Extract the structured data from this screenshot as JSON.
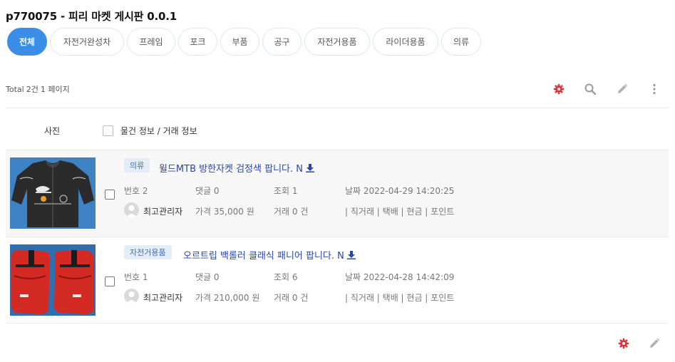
{
  "board": {
    "title": "p770075 - 피리 마켓 게시판 0.0.1"
  },
  "tabs": [
    {
      "label": "전체",
      "active": true
    },
    {
      "label": "자전거완성차"
    },
    {
      "label": "프레임"
    },
    {
      "label": "포크"
    },
    {
      "label": "부품"
    },
    {
      "label": "공구"
    },
    {
      "label": "자전거용품"
    },
    {
      "label": "라이더용품"
    },
    {
      "label": "의류"
    }
  ],
  "summary": {
    "total_label": "Total",
    "total_count": "2건",
    "page": "1 페이지"
  },
  "toolbar_icons": [
    "settings-icon",
    "search-icon",
    "pencil-icon",
    "more-vertical-icon"
  ],
  "list_header": {
    "photo": "사진",
    "info": "물건 정보 / 거래 정보"
  },
  "items": [
    {
      "category": "의류",
      "title": "윌드MTB 방한자켓 검정색 팝니다. N",
      "number": "번호 2",
      "comments": "댓글 0",
      "views": "조회 1",
      "date": "날짜 2022-04-29 14:20:25",
      "author": "최고관리자",
      "price": "가격 35,000 원",
      "trades": "거래 0 건",
      "trade_methods": "| 직거래 | 택배 | 현금 | 포인트",
      "thumb": "black-cycling-jacket"
    },
    {
      "category": "자전거용품",
      "title": "오르트립 백롤러 클래식 패니어 팝니다. N",
      "number": "번호 1",
      "comments": "댓글 0",
      "views": "조회 6",
      "date": "날짜 2022-04-28 14:42:09",
      "author": "최고관리자",
      "price": "가격 210,000 원",
      "trades": "거래 0 건",
      "trade_methods": "| 직거래 | 택배 | 현금 | 포인트",
      "thumb": "red-pannier-bags"
    }
  ],
  "colors": {
    "accent": "#3b8ee8",
    "link": "#2b47a6",
    "gear": "#d9343f",
    "badge_bg": "#e4ecf7"
  }
}
